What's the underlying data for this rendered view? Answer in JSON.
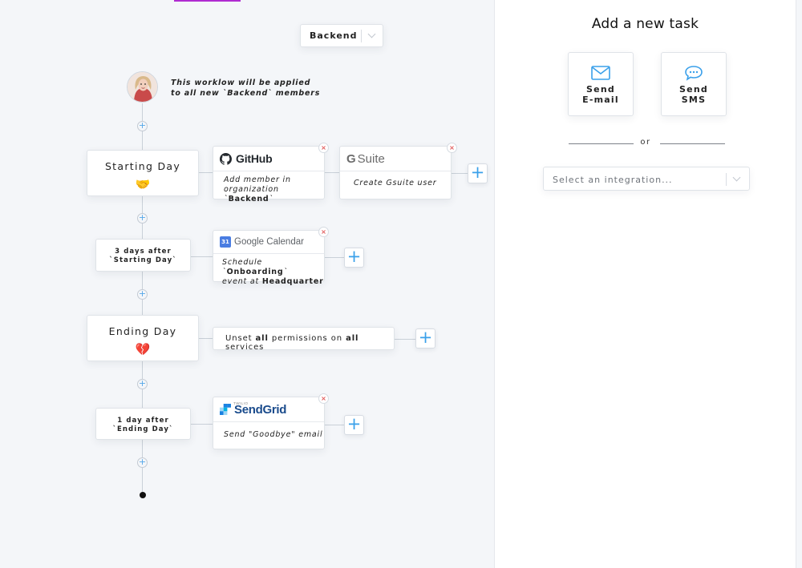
{
  "team_select": {
    "value": "Backend"
  },
  "intro": {
    "line1": "This worklow will be applied",
    "line2": "to all new `Backend` members"
  },
  "nodes": [
    {
      "title": "Starting Day",
      "emoji": "🤝"
    },
    {
      "line1": "3 days after",
      "line2": "`Starting Day`"
    },
    {
      "title": "Ending Day",
      "emoji": "💔"
    },
    {
      "line1": "1 day after",
      "line2": "`Ending Day`"
    }
  ],
  "tasks": {
    "github": {
      "brand": "GitHub",
      "text_a": "Add member in",
      "text_b": "organization `",
      "text_c": "Backend",
      "text_d": "`"
    },
    "gsuite": {
      "brand_g": "G",
      "brand": "Suite",
      "text": "Create Gsuite user"
    },
    "gcal": {
      "icon_num": "31",
      "brand": "Google Calendar",
      "text_a": "Schedule `",
      "text_b": "Onboarding",
      "text_c": "`",
      "text_d": "event at ",
      "text_e": "Headquarter"
    },
    "unset": {
      "a": "Unset ",
      "b": "all",
      "c": " permissions on ",
      "d": "all",
      "e": " services"
    },
    "sendgrid": {
      "twilio": "TWILIO",
      "brand": "SendGrid",
      "text": "Send \"Goodbye\" email"
    }
  },
  "panel": {
    "title": "Add a new task",
    "send_email": {
      "line1": "Send",
      "line2": "E-mail"
    },
    "send_sms": {
      "line1": "Send",
      "line2": "SMS"
    },
    "or": "or",
    "integration_placeholder": "Select an integration..."
  },
  "symbols": {
    "plus": "+",
    "close": "×"
  },
  "colors": {
    "accent": "#b02bd1",
    "plus_blue": "#3aa0ea",
    "close_red": "#e05757",
    "canvas_bg": "#f4f6f9"
  }
}
